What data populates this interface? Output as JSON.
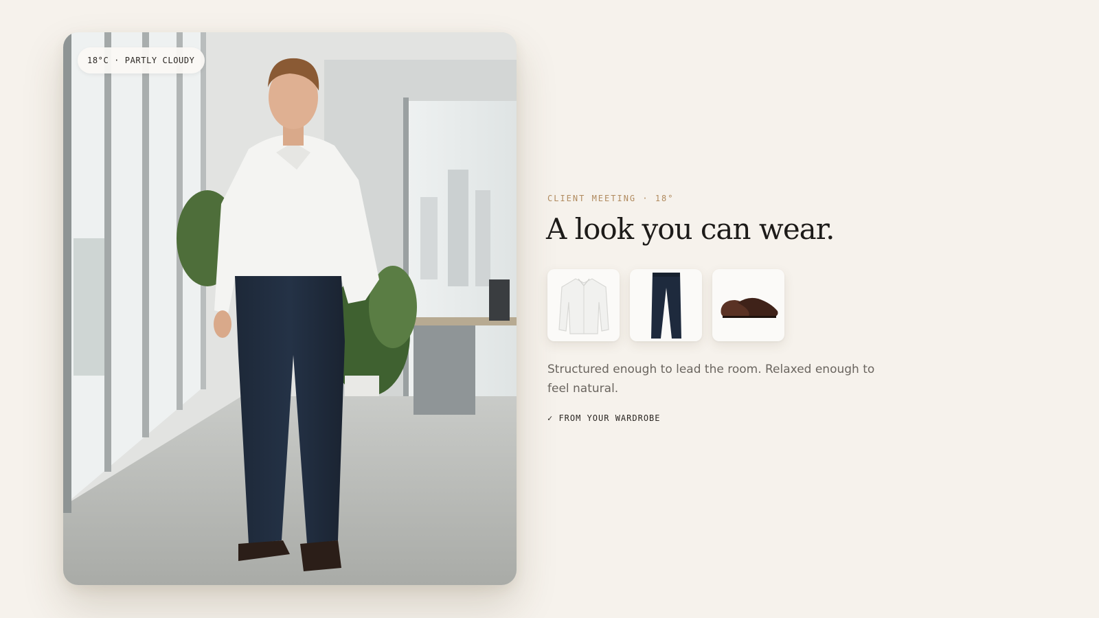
{
  "photo": {
    "weather_badge": "18°C · PARTLY CLOUDY",
    "subject": "man in white shirt and navy trousers standing in office by window"
  },
  "outfit": {
    "eyebrow": "CLIENT MEETING · 18°",
    "headline": "A look you can wear.",
    "items": [
      {
        "name": "white-shirt"
      },
      {
        "name": "navy-trousers"
      },
      {
        "name": "brown-loafers"
      }
    ],
    "description": "Structured enough to lead the room. Relaxed enough to feel natural.",
    "source_label": "✓ FROM YOUR WARDROBE"
  }
}
